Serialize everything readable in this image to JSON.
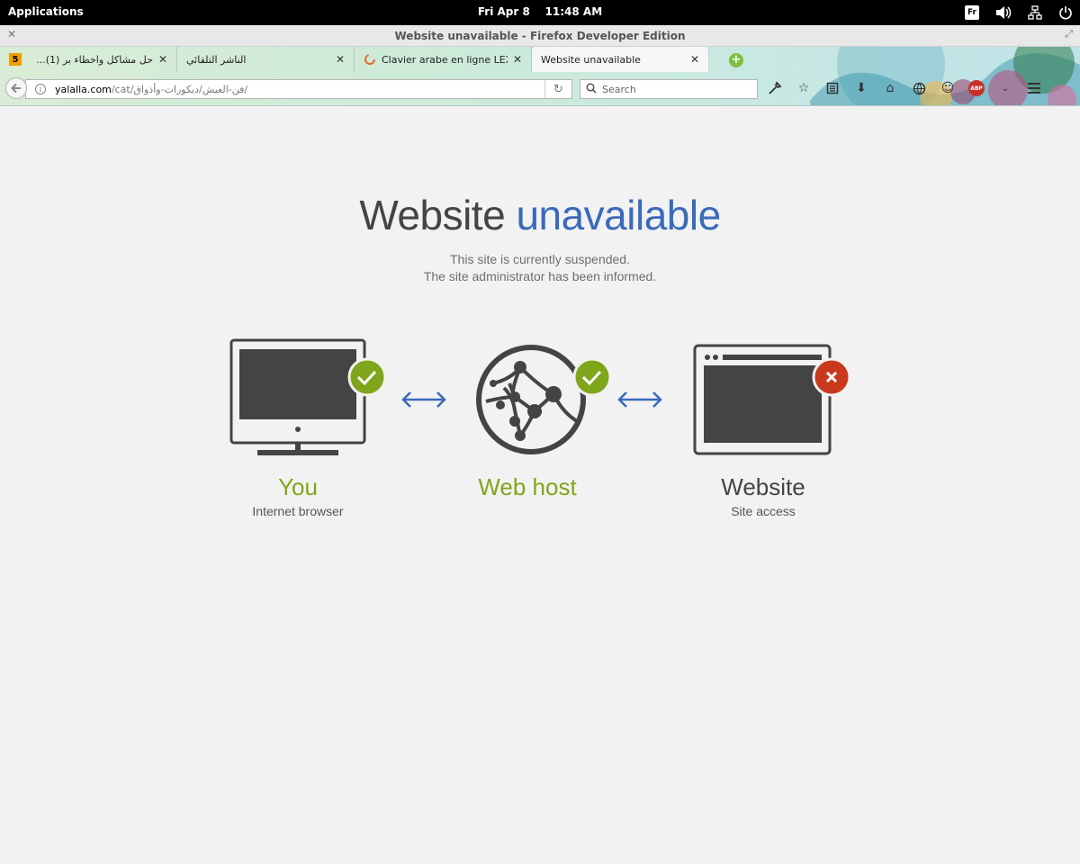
{
  "topbar": {
    "applications": "Applications",
    "date": "Fri Apr  8",
    "time": "11:48 AM",
    "keyboard_layout": "Fr",
    "icons": [
      "volume-icon",
      "network-icon",
      "power-icon"
    ]
  },
  "window": {
    "title": "Website unavailable - Firefox Developer Edition"
  },
  "tabs": [
    {
      "label": "حل مشاكل واخطاء بر (1)...",
      "favicon": "5",
      "active": false
    },
    {
      "label": "الناشر التلقائي",
      "active": false
    },
    {
      "label": "Clavier arabe en ligne LEXI...",
      "active": false
    },
    {
      "label": "Website unavailable",
      "active": true
    }
  ],
  "navbar": {
    "url_host": "yalalla.com",
    "url_path": "/cat/فن-العيش/ديكورات-وأذواق/",
    "search_placeholder": "Search",
    "abp_label": "ABP"
  },
  "page": {
    "headline_main": "Website",
    "headline_accent": "unavailable",
    "line1": "This site is currently suspended.",
    "line2": "The site administrator has been informed.",
    "nodes": [
      {
        "title": "You",
        "subtitle": "Internet browser",
        "status": "ok"
      },
      {
        "title": "Web host",
        "subtitle": "",
        "status": "ok"
      },
      {
        "title": "Website",
        "subtitle": "Site access",
        "status": "error"
      }
    ]
  },
  "colors": {
    "accent_blue": "#3b6ab8",
    "ok_green": "#7fa61a",
    "error_red": "#c9391e",
    "icon_dark": "#444444"
  }
}
